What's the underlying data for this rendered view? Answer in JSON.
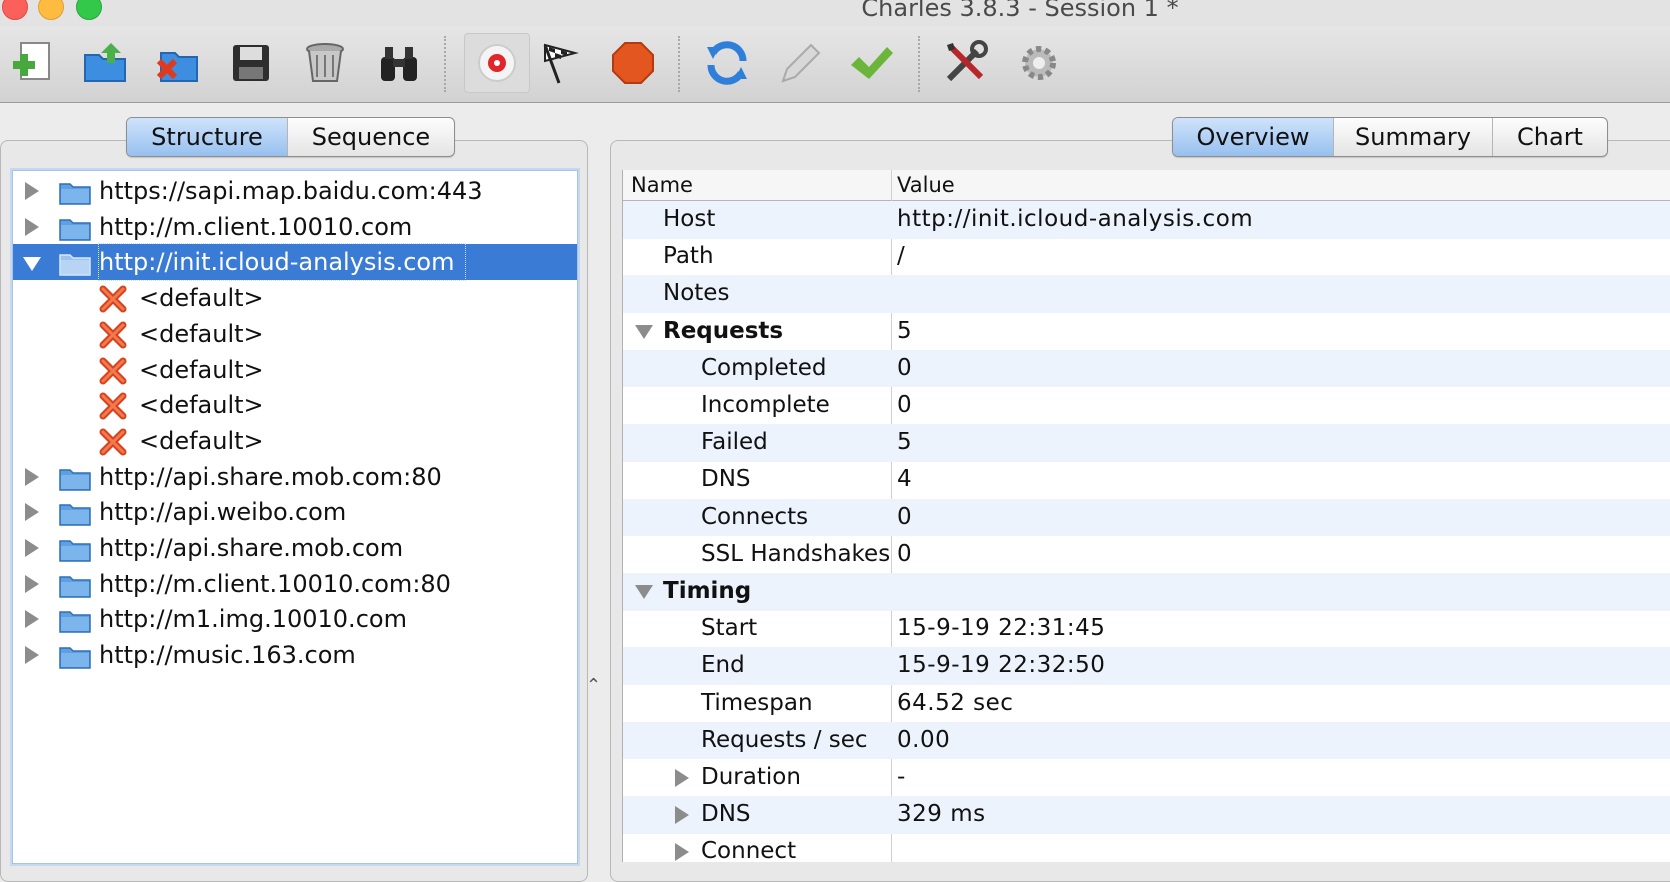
{
  "window": {
    "title": "Charles 3.8.3 - Session 1 *"
  },
  "toolbar": {
    "buttons": [
      "new-session",
      "open",
      "close-session",
      "save",
      "clear",
      "find",
      "record",
      "throttle",
      "stop",
      "refresh",
      "edit",
      "validate",
      "tools",
      "settings"
    ]
  },
  "left_tabs": [
    "Structure",
    "Sequence"
  ],
  "left_tabs_selected": "Structure",
  "right_tabs": [
    "Overview",
    "Summary",
    "Chart"
  ],
  "right_tabs_selected": "Overview",
  "tree": {
    "hosts": [
      {
        "label": "https://sapi.map.baidu.com:443",
        "expanded": false
      },
      {
        "label": "http://m.client.10010.com",
        "expanded": false
      },
      {
        "label": "http://init.icloud-analysis.com",
        "expanded": true,
        "selected": true,
        "children": [
          "<default>",
          "<default>",
          "<default>",
          "<default>",
          "<default>"
        ]
      },
      {
        "label": "http://api.share.mob.com:80",
        "expanded": false
      },
      {
        "label": "http://api.weibo.com",
        "expanded": false
      },
      {
        "label": "http://api.share.mob.com",
        "expanded": false
      },
      {
        "label": "http://m.client.10010.com:80",
        "expanded": false
      },
      {
        "label": "http://m1.img.10010.com",
        "expanded": false
      },
      {
        "label": "http://music.163.com",
        "expanded": false
      }
    ]
  },
  "overview": {
    "header_name": "Name",
    "header_value": "Value",
    "rows": [
      {
        "name": "Host",
        "value": "http://init.icloud-analysis.com",
        "level": 1
      },
      {
        "name": "Path",
        "value": "/",
        "level": 1
      },
      {
        "name": "Notes",
        "value": "",
        "level": 1
      },
      {
        "name": "Requests",
        "value": "5",
        "level": 1,
        "group": "open",
        "bold": true
      },
      {
        "name": "Completed",
        "value": "0",
        "level": 2
      },
      {
        "name": "Incomplete",
        "value": "0",
        "level": 2
      },
      {
        "name": "Failed",
        "value": "5",
        "level": 2
      },
      {
        "name": "DNS",
        "value": "4",
        "level": 2
      },
      {
        "name": "Connects",
        "value": "0",
        "level": 2
      },
      {
        "name": "SSL Handshakes",
        "value": "0",
        "level": 2
      },
      {
        "name": "Timing",
        "value": "",
        "level": 1,
        "group": "open",
        "bold": true
      },
      {
        "name": "Start",
        "value": "15-9-19 22:31:45",
        "level": 2
      },
      {
        "name": "End",
        "value": "15-9-19 22:32:50",
        "level": 2
      },
      {
        "name": "Timespan",
        "value": "64.52 sec",
        "level": 2
      },
      {
        "name": "Requests / sec",
        "value": "0.00",
        "level": 2
      },
      {
        "name": "Duration",
        "value": "-",
        "level": 2,
        "group": "closed"
      },
      {
        "name": "DNS",
        "value": "329 ms",
        "level": 2,
        "group": "closed"
      },
      {
        "name": "Connect",
        "value": "",
        "level": 2,
        "group": "closed"
      }
    ]
  },
  "colors": {
    "selection": "#3a7bd5",
    "alt_row": "#edf3fd",
    "segment_selected": "#97c0ef"
  }
}
